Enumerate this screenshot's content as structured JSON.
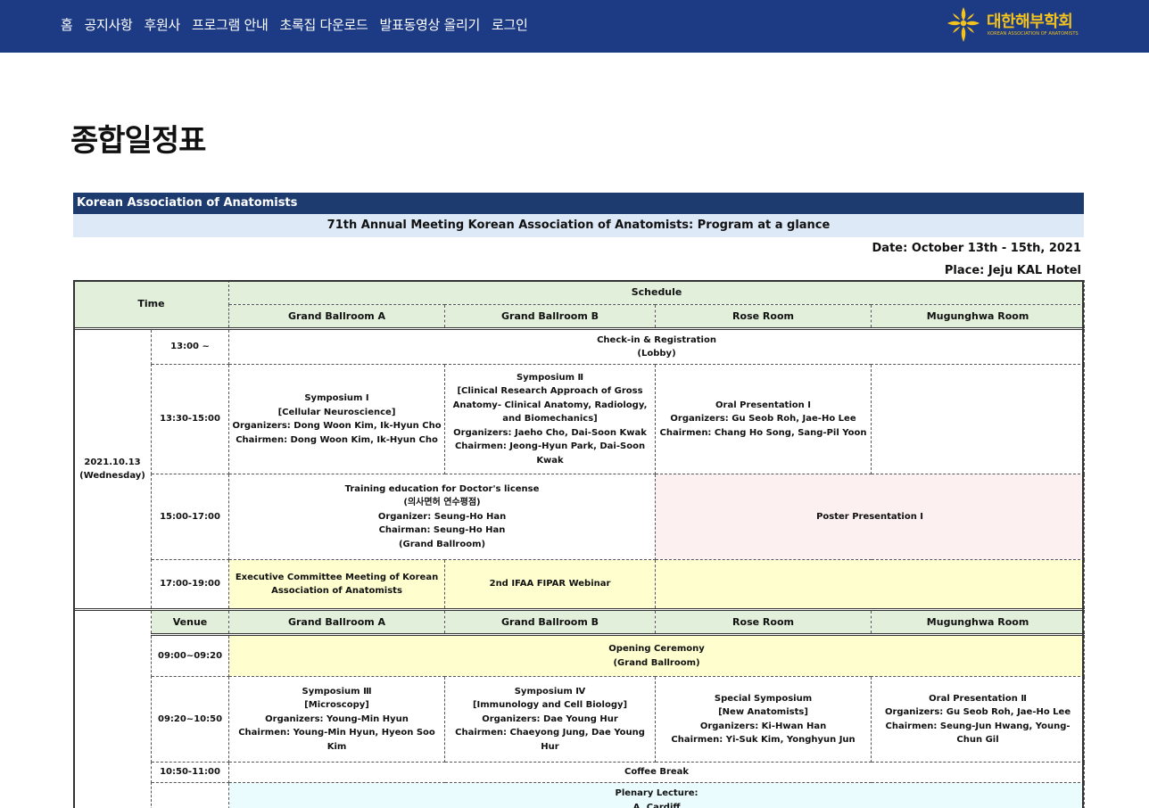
{
  "nav": {
    "items": [
      "홈",
      "공지사항",
      "후원사",
      "프로그램 안내",
      "초록집 다운로드",
      "발표동영상 올리기",
      "로그인"
    ]
  },
  "logo": {
    "kr": "대한해부학회",
    "en": "KOREAN ASSOCIATION OF ANATOMISTS",
    "icon": "cross-flower-icon",
    "color": "#f3c21c"
  },
  "colors": {
    "navbar": "#1d3b85",
    "header_green": "#e2efda",
    "pink": "#fdf0f0",
    "yellow": "#fefecf",
    "cyan": "#eafcfd"
  },
  "page": {
    "title": "종합일정표"
  },
  "doc": {
    "org": "Korean Association of Anatomists",
    "heading": "71th Annual Meeting Korean Association of Anatomists: Program at a glance",
    "date": "Date: October 13th - 15th, 2021",
    "place": "Place: Jeju KAL Hotel"
  },
  "schedule": {
    "time_header": "Time",
    "schedule_header": "Schedule",
    "rooms": [
      "Grand Ballroom A",
      "Grand Ballroom B",
      "Rose Room",
      "Mugunghwa Room"
    ],
    "venue_header": "Venue",
    "day1": {
      "date": "2021.10.13",
      "weekday": "(Wednesday)",
      "rows": {
        "r1": {
          "time": "13:00 ~",
          "line1": "Check-in & Registration",
          "line2": "(Lobby)"
        },
        "r2": {
          "time": "13:30-15:00",
          "a": [
            "Symposium Ⅰ",
            "[Cellular Neuroscience]",
            "Organizers: Dong Woon Kim, Ik-Hyun Cho",
            "Chairmen: Dong Woon Kim, Ik-Hyun Cho"
          ],
          "b": [
            "Symposium Ⅱ",
            "[Clinical Research Approach of Gross",
            "Anatomy- Clinical Anatomy, Radiology,",
            "and Biomechanics]",
            "Organizers: Jaeho Cho, Dai-Soon Kwak",
            "Chairmen: Jeong-Hyun Park, Dai-Soon Kwak"
          ],
          "c": [
            "Oral Presentation Ⅰ",
            "Organizers: Gu Seob Roh, Jae-Ho Lee",
            "Chairmen: Chang Ho Song, Sang-Pil Yoon"
          ]
        },
        "r3": {
          "time": "15:00-17:00",
          "ab": [
            "Training education for Doctor's license",
            "(의사면허 연수평점)",
            "Organizer: Seung-Ho Han",
            "Chairman: Seung-Ho Han",
            "(Grand Ballroom)"
          ],
          "cd": "Poster Presentation Ⅰ"
        },
        "r4": {
          "time": "17:00-19:00",
          "a": [
            "Executive Committee Meeting of Korean",
            "Association of Anatomists"
          ],
          "b": "2nd IFAA FIPAR Webinar"
        }
      }
    },
    "day2": {
      "rows": {
        "r1": {
          "time": "09:00~09:20",
          "line1": "Opening Ceremony",
          "line2": "(Grand Ballroom)"
        },
        "r2": {
          "time": "09:20~10:50",
          "a": [
            "Symposium Ⅲ",
            "[Microscopy]",
            "Organizers: Young-Min Hyun",
            "Chairmen: Young-Min Hyun, Hyeon Soo Kim"
          ],
          "b": [
            "Symposium Ⅳ",
            "[Immunology and Cell Biology]",
            "Organizers: Dae Young Hur",
            "Chairmen: Chaeyong Jung, Dae Young Hur"
          ],
          "c": [
            "Special Symposium",
            "[New Anatomists]",
            "Organizers: Ki-Hwan Han",
            "Chairmen: Yi-Suk Kim, Yonghyun Jun"
          ],
          "d": [
            "Oral Presentation Ⅱ",
            "Organizers: Gu Seob Roh, Jae-Ho Lee",
            "Chairmen: Seung-Jun Hwang, Young-Chun Gil"
          ]
        },
        "r3": {
          "time": "10:50-11:00",
          "text": "Coffee Break"
        },
        "r4": {
          "line1": "Plenary Lecture:",
          "line2": "A. Cardiff"
        }
      }
    }
  }
}
